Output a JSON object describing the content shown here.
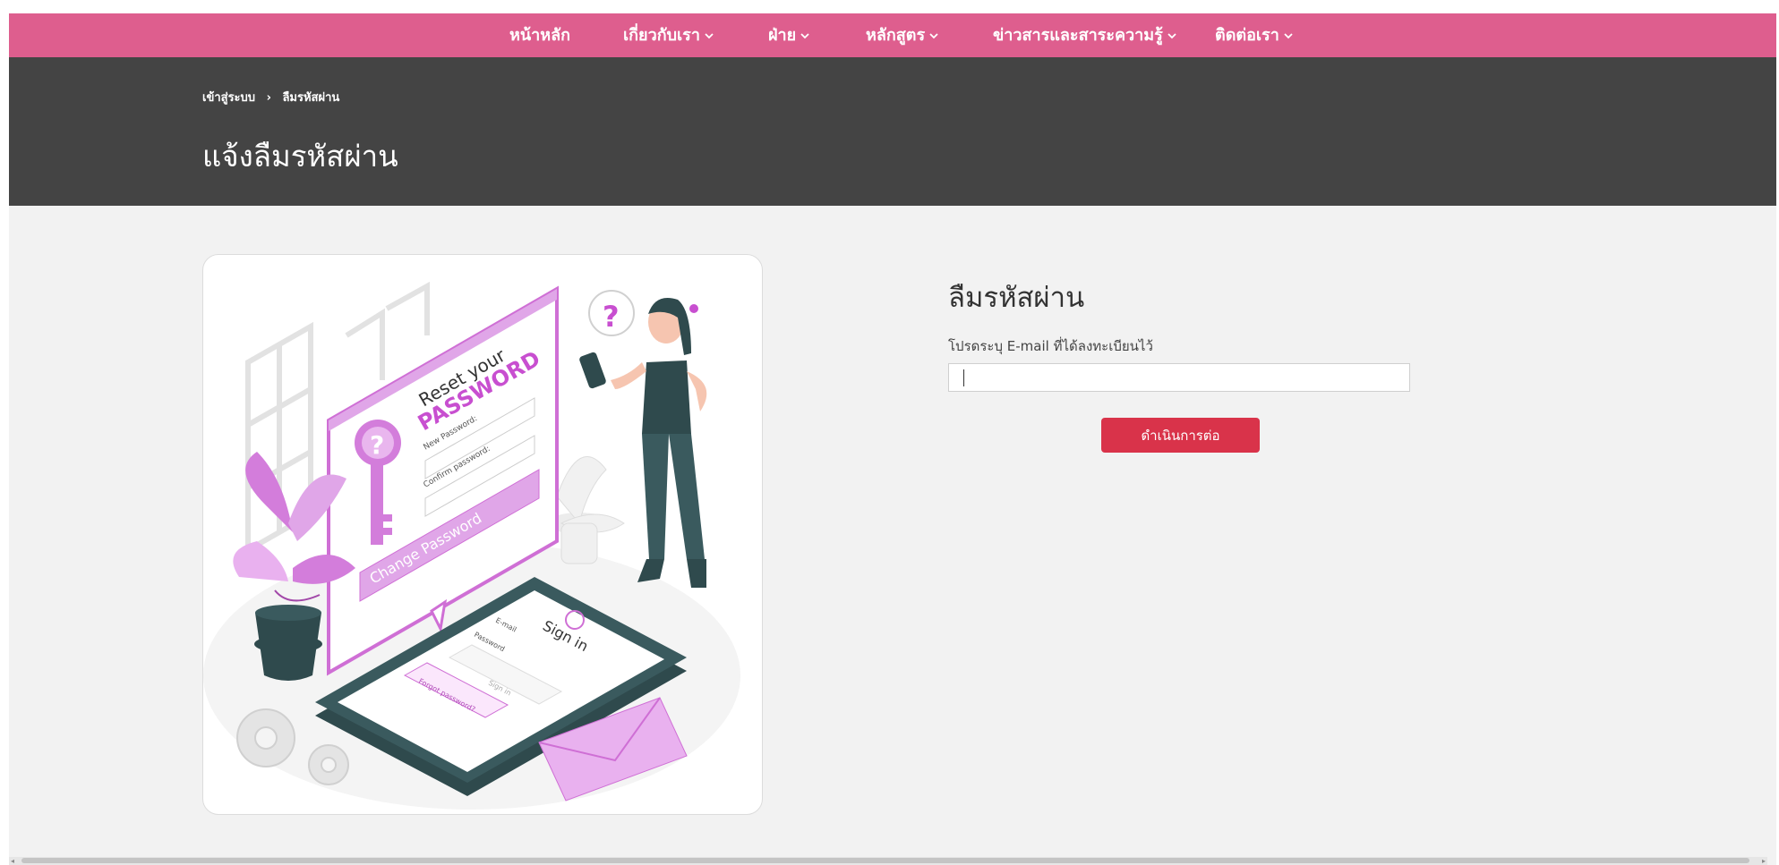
{
  "nav": {
    "items": [
      {
        "label": "หน้าหลัก",
        "dropdown": false
      },
      {
        "label": "เกี่ยวกับเรา",
        "dropdown": true
      },
      {
        "label": "ฝ่าย",
        "dropdown": true
      },
      {
        "label": "หลักสูตร",
        "dropdown": true
      },
      {
        "label": "ข่าวสารและสาระความรู้",
        "dropdown": true
      },
      {
        "label": "ติดต่อเรา",
        "dropdown": true
      }
    ]
  },
  "breadcrumb": {
    "home": "เข้าสู่ระบบ",
    "separator": "›",
    "current": "ลืมรหัสผ่าน"
  },
  "hero": {
    "title": "แจ้งลืมรหัสผ่าน"
  },
  "illustration": {
    "reset_line1": "Reset your",
    "reset_line2": "PASSWORD",
    "new_password_label": "New Password:",
    "confirm_password_label": "Confirm password:",
    "change_password_label": "Change Password",
    "phone_title": "Sign in",
    "phone_email_label": "E-mail",
    "phone_password_label": "Password",
    "phone_signin_button": "Sign in",
    "phone_forgot_link": "Forgot password?"
  },
  "form": {
    "title": "ลืมรหัสผ่าน",
    "email_label": "โปรดระบุ E-mail ที่ได้ลงทะเบียนไว้",
    "email_value": "",
    "email_placeholder": "",
    "submit_label": "ดำเนินการต่อ"
  },
  "colors": {
    "nav_bg": "#de5e8e",
    "hero_bg": "#444444",
    "button_bg": "#d9334a",
    "accent_pink": "#e0a6e8"
  }
}
